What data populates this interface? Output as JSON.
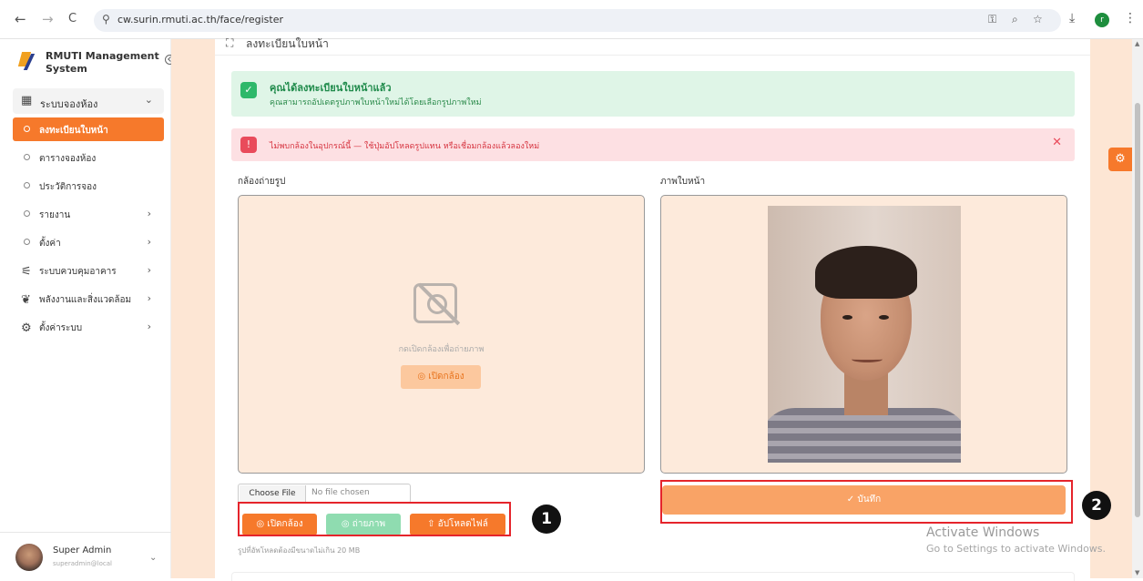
{
  "browser": {
    "back_icon": "←",
    "forward_icon": "→",
    "reload_icon": "C",
    "url": "cw.surin.rmuti.ac.th/face/register",
    "profile_initial": "r"
  },
  "sidebar": {
    "brand_line1": "RMUTI Management",
    "brand_line2": "System",
    "group": "ระบบจองห้อง",
    "items": [
      {
        "label": "ลงทะเบียนใบหน้า"
      },
      {
        "label": "ตารางจองห้อง"
      },
      {
        "label": "ประวัติการจอง"
      },
      {
        "label": "รายงาน"
      },
      {
        "label": "ตั้งค่า"
      }
    ],
    "sections": [
      {
        "label": "ระบบควบคุมอาคาร"
      },
      {
        "label": "พลังงานและสิ่งแวดล้อม"
      },
      {
        "label": "ตั้งค่าระบบ"
      }
    ],
    "user_name": "Super Admin",
    "user_email": "superadmin@local"
  },
  "page": {
    "title": "ลงทะเบียนใบหน้า",
    "success_title": "คุณได้ลงทะเบียนใบหน้าแล้ว",
    "success_sub": "คุณสามารถอัปเดตรูปภาพใบหน้าใหม่ได้โดยเลือกรูปภาพใหม่",
    "error_text": "ไม่พบกล้องในอุปกรณ์นี้ — ใช้ปุ่มอัปโหลดรูปแทน หรือเชื่อมกล้องแล้วลองใหม่",
    "camera_label": "กล้องถ่ายรูป",
    "face_label": "ภาพใบหน้า",
    "camera_hint": "กดเปิดกล้องเพื่อถ่ายภาพ",
    "open_camera": "◎ เปิดกล้อง",
    "choose_file": "Choose File",
    "no_file": "No file chosen",
    "btn_open_camera": "◎ เปิดกล้อง",
    "btn_capture": "◎ ถ่ายภาพ",
    "btn_upload": "⇧ อัปโหลดไฟล์",
    "btn_save": "✓ บันทึก",
    "note": "รูปที่อัพโหลดต้องมีขนาดไม่เกิน 20 MB"
  },
  "annotations": {
    "badge1": "1",
    "badge2": "2"
  },
  "watermark": {
    "line1": "Activate Windows",
    "line2": "Go to Settings to activate Windows."
  },
  "colors": {
    "accent": "#f6792b",
    "success": "#2eb86a",
    "error": "#e94b5b",
    "highlight": "#e5242b"
  }
}
